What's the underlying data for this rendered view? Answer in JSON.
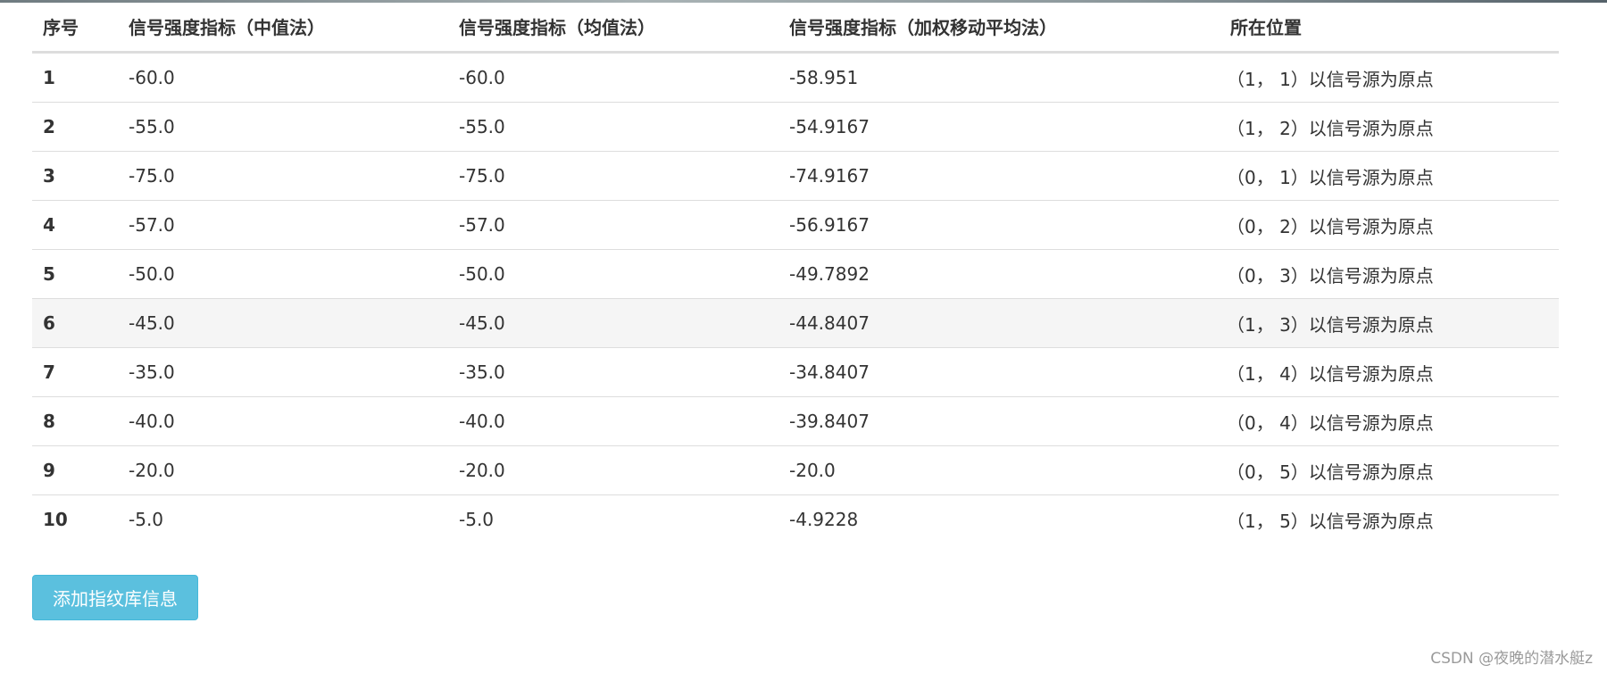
{
  "table": {
    "headers": [
      "序号",
      "信号强度指标（中值法）",
      "信号强度指标（均值法）",
      "信号强度指标（加权移动平均法）",
      "所在位置"
    ],
    "rows": [
      {
        "index": "1",
        "median": "-60.0",
        "mean": "-60.0",
        "wma": "-58.951",
        "position": "（1， 1）以信号源为原点"
      },
      {
        "index": "2",
        "median": "-55.0",
        "mean": "-55.0",
        "wma": "-54.9167",
        "position": "（1， 2）以信号源为原点"
      },
      {
        "index": "3",
        "median": "-75.0",
        "mean": "-75.0",
        "wma": "-74.9167",
        "position": "（0， 1）以信号源为原点"
      },
      {
        "index": "4",
        "median": "-57.0",
        "mean": "-57.0",
        "wma": "-56.9167",
        "position": "（0， 2）以信号源为原点"
      },
      {
        "index": "5",
        "median": "-50.0",
        "mean": "-50.0",
        "wma": "-49.7892",
        "position": "（0， 3）以信号源为原点"
      },
      {
        "index": "6",
        "median": "-45.0",
        "mean": "-45.0",
        "wma": "-44.8407",
        "position": "（1， 3）以信号源为原点"
      },
      {
        "index": "7",
        "median": "-35.0",
        "mean": "-35.0",
        "wma": "-34.8407",
        "position": "（1， 4）以信号源为原点"
      },
      {
        "index": "8",
        "median": "-40.0",
        "mean": "-40.0",
        "wma": "-39.8407",
        "position": "（0， 4）以信号源为原点"
      },
      {
        "index": "9",
        "median": "-20.0",
        "mean": "-20.0",
        "wma": "-20.0",
        "position": "（0， 5）以信号源为原点"
      },
      {
        "index": "10",
        "median": "-5.0",
        "mean": "-5.0",
        "wma": "-4.9228",
        "position": "（1， 5）以信号源为原点"
      }
    ]
  },
  "actions": {
    "add_button_label": "添加指纹库信息"
  },
  "watermark": "CSDN @夜晚的潜水艇z",
  "colors": {
    "button_bg": "#5bc0de",
    "row_hover_bg": "#f5f5f5",
    "border": "#dddddd",
    "text": "#333333"
  }
}
